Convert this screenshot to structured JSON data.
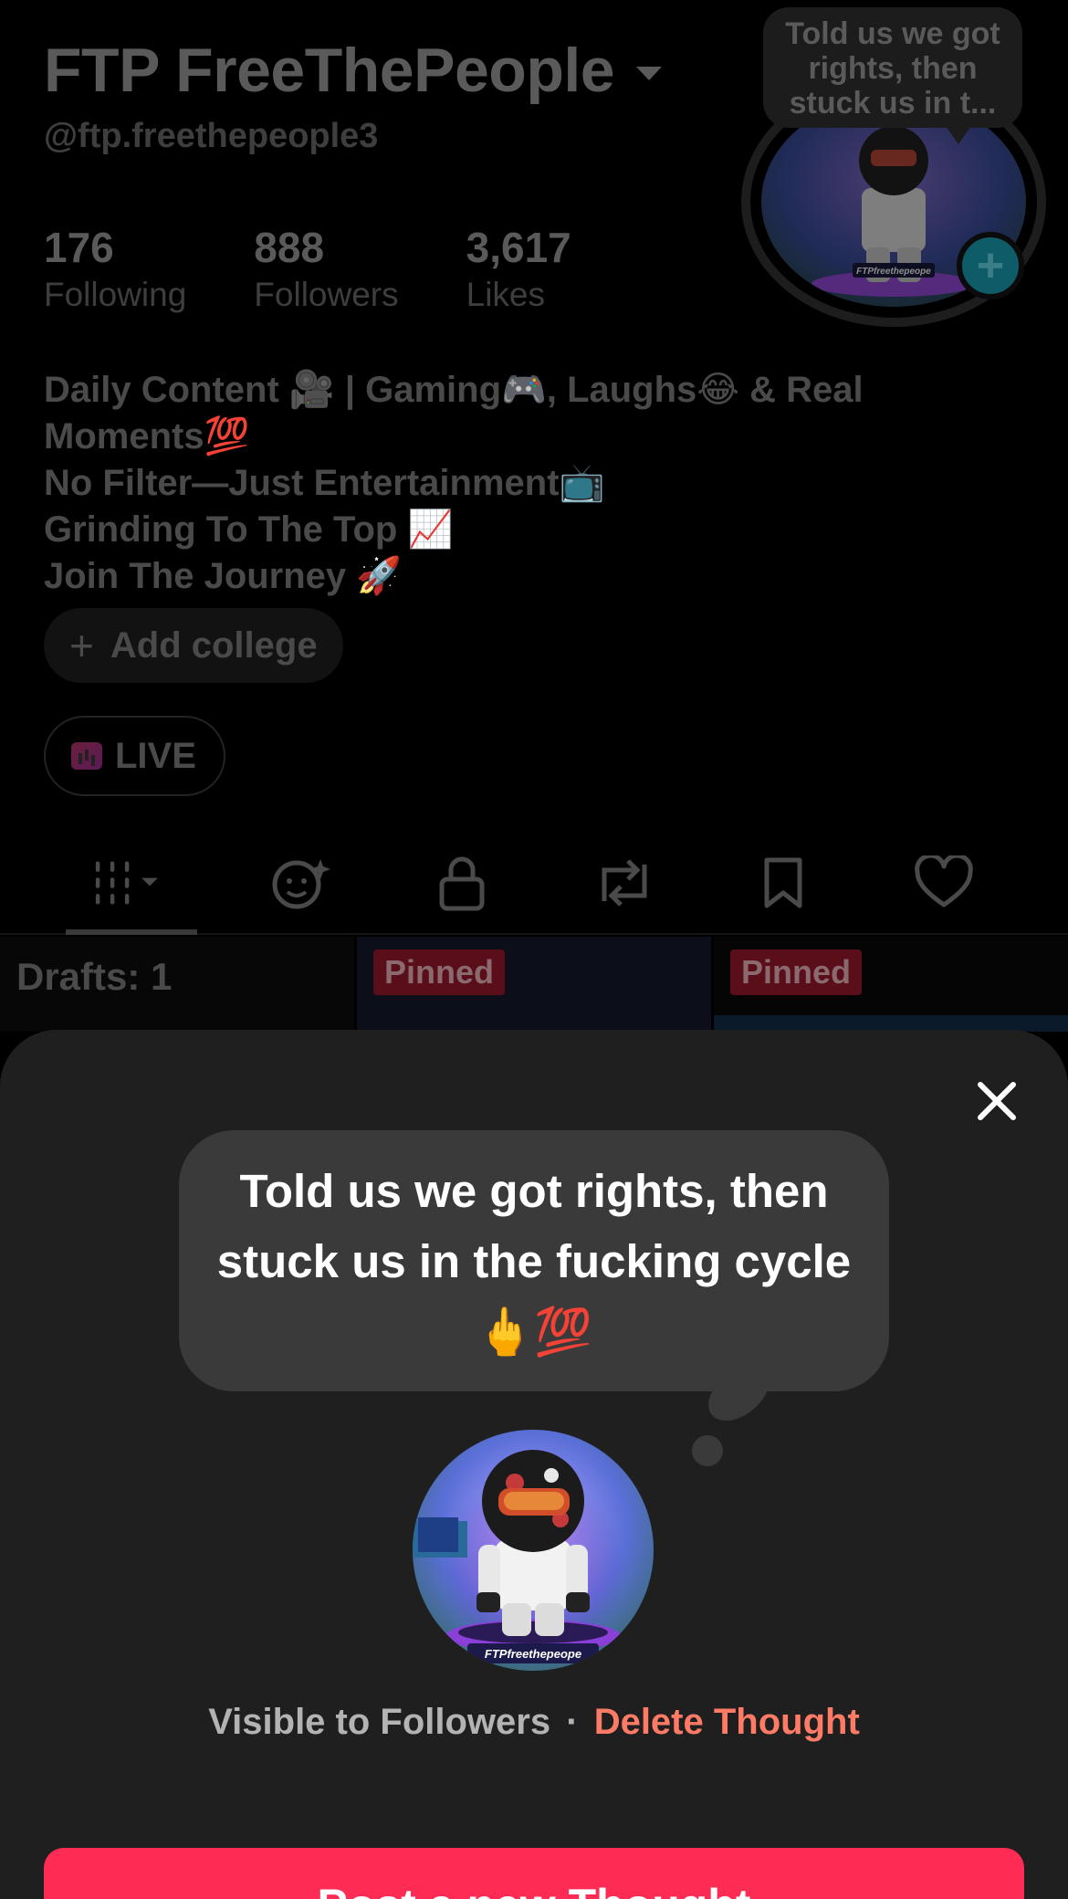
{
  "profile": {
    "display_name": "FTP FreeThePeople",
    "handle": "@ftp.freethepeople3",
    "stats": {
      "following": {
        "value": "176",
        "label": "Following"
      },
      "followers": {
        "value": "888",
        "label": "Followers"
      },
      "likes": {
        "value": "3,617",
        "label": "Likes"
      }
    },
    "avatar_thought_preview": "Told us we got rights, then stuck us in t...",
    "avatar_caption": "FTPfreethepeope",
    "bio_lines": [
      "Daily Content 🎥 | Gaming🎮, Laughs😂 & Real",
      "Moments💯",
      "No Filter—Just Entertainment📺",
      "Grinding To The Top 📈",
      "Join The Journey 🚀"
    ],
    "add_college_label": "Add college",
    "live_label": "LIVE"
  },
  "tabs": [
    {
      "name": "videos",
      "icon": "grid-icon"
    },
    {
      "name": "friends",
      "icon": "face-sparkle-icon"
    },
    {
      "name": "private",
      "icon": "lock-icon"
    },
    {
      "name": "reposts",
      "icon": "repost-icon"
    },
    {
      "name": "favorites",
      "icon": "bookmark-icon"
    },
    {
      "name": "liked",
      "icon": "heart-icon"
    }
  ],
  "grid": {
    "drafts_label": "Drafts: 1",
    "pinned_label": "Pinned"
  },
  "sheet": {
    "thought_text": "Told us we got rights, then stuck us in the fucking cycle 🖕💯",
    "visibility_text": "Visible to Followers",
    "separator": "·",
    "delete_label": "Delete Thought",
    "post_button_label": "Post a new Thought"
  },
  "colors": {
    "accent": "#fe2c55",
    "delete": "#ff7b66",
    "sheet_bg": "#1f1f1f",
    "bubble_bg": "#3a3a3a"
  }
}
